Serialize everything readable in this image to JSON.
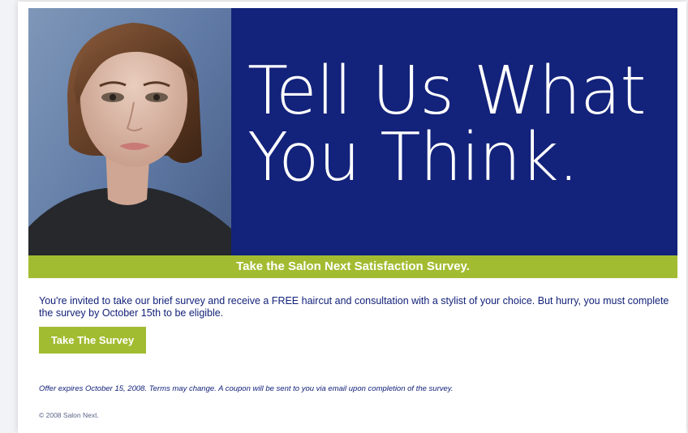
{
  "hero": {
    "headline_line1": "Tell Us What",
    "headline_line2": "You Think.",
    "background_color": "#13227a",
    "photo": "model-portrait"
  },
  "ribbon": {
    "text": "Take the Salon Next Satisfaction Survey.",
    "color": "#a2bc31"
  },
  "intro": {
    "text": "You're invited to take our brief survey and receive a FREE haircut and consultation with a stylist of your choice. But hurry, you must complete the survey by October 15th to be eligible."
  },
  "cta": {
    "label": "Take The Survey",
    "color": "#a2bc31"
  },
  "footer": {
    "terms": "Offer expires October 15, 2008. Terms may change. A coupon will be sent to you via email upon completion of the survey.",
    "copyright": "© 2008 Salon Next."
  }
}
